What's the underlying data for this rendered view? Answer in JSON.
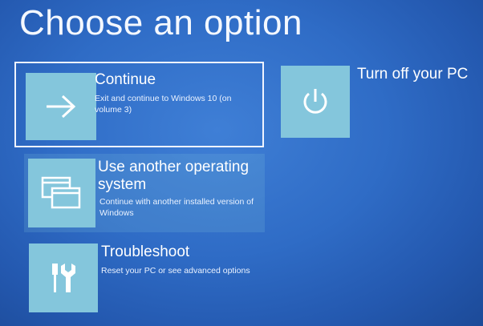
{
  "header": {
    "title": "Choose an option"
  },
  "options": {
    "continue": {
      "label": "Continue",
      "description": "Exit and continue to Windows 10 (on volume 3)",
      "icon": "arrow-right-icon"
    },
    "other_os": {
      "label": "Use another operating system",
      "description": "Continue with another installed version of Windows",
      "icon": "windows-stack-icon"
    },
    "troubleshoot": {
      "label": "Troubleshoot",
      "description": "Reset your PC or see advanced options",
      "icon": "tools-icon"
    },
    "turn_off": {
      "label": "Turn off your PC",
      "icon": "power-icon"
    }
  },
  "colors": {
    "background": "#2f6cc6",
    "tile": "#84c6dc",
    "text": "#ffffff"
  }
}
